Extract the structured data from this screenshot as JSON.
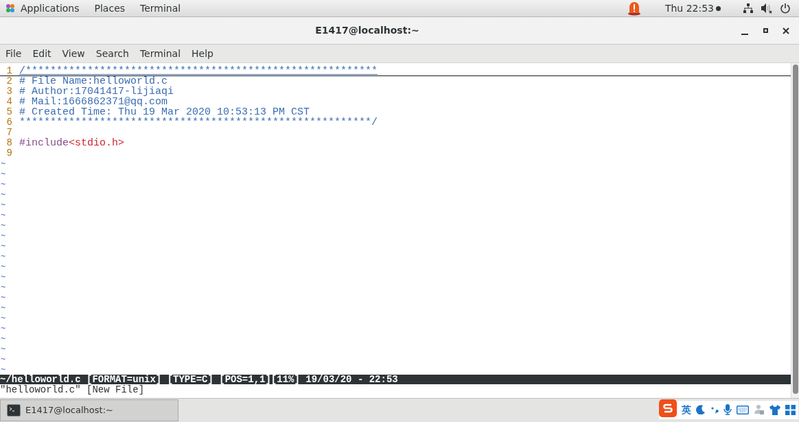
{
  "top_bar": {
    "menus": [
      "Applications",
      "Places",
      "Terminal"
    ],
    "clock": "Thu 22:53"
  },
  "window": {
    "title": "E1417@localhost:~"
  },
  "menu_bar": [
    "File",
    "Edit",
    "View",
    "Search",
    "Terminal",
    "Help"
  ],
  "editor": {
    "lines": [
      {
        "number": "1",
        "cursor_line": true,
        "segments": [
          {
            "kind": "comment",
            "text": "/*********************************************************"
          }
        ]
      },
      {
        "number": "2",
        "cursor_line": false,
        "segments": [
          {
            "kind": "comment",
            "text": "# File Name:helloworld.c"
          }
        ]
      },
      {
        "number": "3",
        "cursor_line": false,
        "segments": [
          {
            "kind": "comment",
            "text": "# Author:17041417-lijiaqi"
          }
        ]
      },
      {
        "number": "4",
        "cursor_line": false,
        "segments": [
          {
            "kind": "comment",
            "text": "# Mail:1666862371@qq.com"
          }
        ]
      },
      {
        "number": "5",
        "cursor_line": false,
        "segments": [
          {
            "kind": "comment",
            "text": "# Created Time: Thu 19 Mar 2020 10:53:13 PM CST"
          }
        ]
      },
      {
        "number": "6",
        "cursor_line": false,
        "segments": [
          {
            "kind": "comment",
            "text": "*********************************************************/"
          }
        ]
      },
      {
        "number": "7",
        "cursor_line": false
      },
      {
        "number": "8",
        "cursor_line": false,
        "segments": [
          {
            "kind": "preproc",
            "text": "#include"
          },
          {
            "kind": "string",
            "text": "<stdio.h>"
          }
        ]
      },
      {
        "number": "9",
        "cursor_line": false
      }
    ],
    "tildes": [
      "~",
      "~",
      "~",
      "~",
      "~",
      "~",
      "~",
      "~",
      "~",
      "~",
      "~",
      "~",
      "~",
      "~",
      "~",
      "~",
      "~",
      "~",
      "~",
      "~",
      "~"
    ],
    "status_line": "~/helloworld.c [FORMAT=unix] [TYPE=C] [POS=1,1][11%] 19/03/20 - 22:53",
    "message": "\"helloworld.c\" [New File]"
  },
  "taskbar": {
    "items": [
      {
        "label": "E1417@localhost:~",
        "selected": true
      }
    ]
  },
  "ime_toolbar": {
    "mode": "英"
  }
}
